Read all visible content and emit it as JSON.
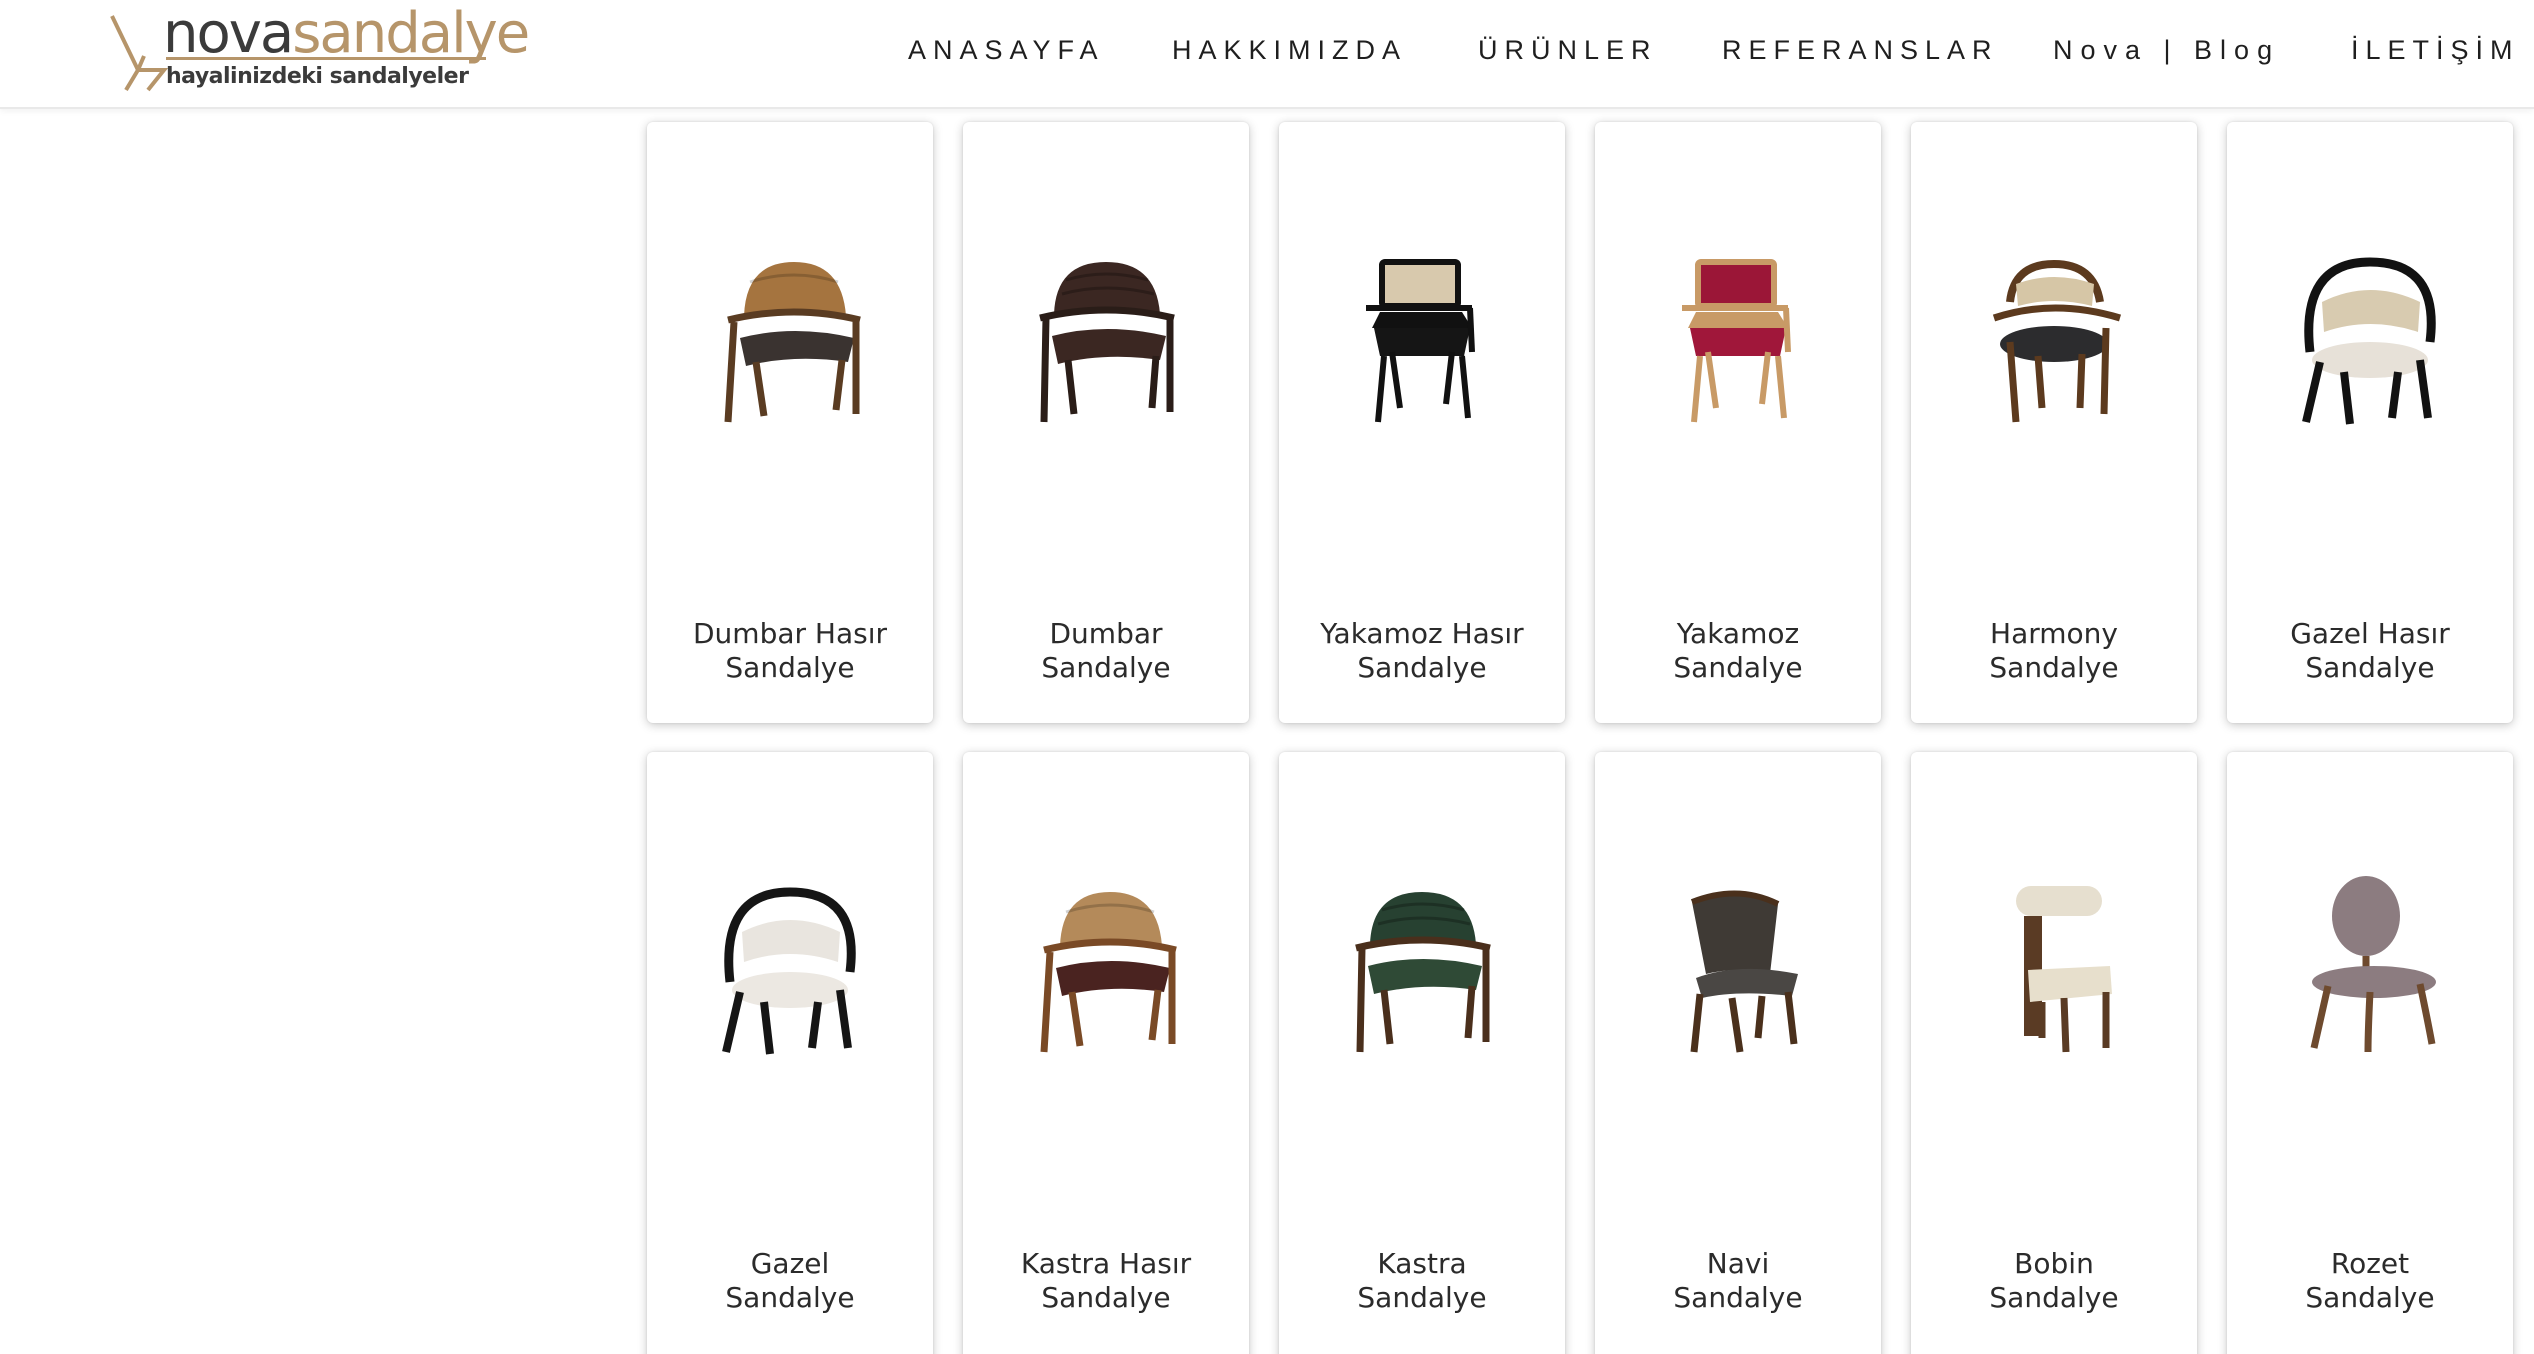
{
  "brand": {
    "name_part1": "nova",
    "name_part2": "sandalye",
    "tagline": "hayalinizdeki sandalyeler",
    "colors": {
      "gold": "#b6956a",
      "dark": "#3b3b3b"
    }
  },
  "nav": [
    {
      "label": "ANASAYFA"
    },
    {
      "label": "HAKKIMIZDA"
    },
    {
      "label": "ÜRÜNLER"
    },
    {
      "label": "REFERANSLAR"
    },
    {
      "label": "Nova | Blog"
    },
    {
      "label": "İLETİŞİM"
    }
  ],
  "products": [
    {
      "title_line1": "Dumbar Hasır",
      "title_line2": "Sandalye",
      "frame": "#5a3c22",
      "back": "#a5743f",
      "seat": "#3a3330",
      "style": "arm-cane"
    },
    {
      "title_line1": "Dumbar",
      "title_line2": "Sandalye",
      "frame": "#2a1d18",
      "back": "#3b2722",
      "seat": "#3b2722",
      "style": "arm-leather"
    },
    {
      "title_line1": "Yakamoz Hasır",
      "title_line2": "Sandalye",
      "frame": "#111111",
      "back": "#d8c9ad",
      "seat": "#151515",
      "style": "square-arm"
    },
    {
      "title_line1": "Yakamoz",
      "title_line2": "Sandalye",
      "frame": "#c89a66",
      "back": "#9b1637",
      "seat": "#a0173a",
      "style": "square-arm"
    },
    {
      "title_line1": "Harmony",
      "title_line2": "Sandalye",
      "frame": "#5c3a1e",
      "back": "#d6c6a6",
      "seat": "#2c2c2e",
      "style": "round-arm"
    },
    {
      "title_line1": "Gazel Hasır",
      "title_line2": "Sandalye",
      "frame": "#121212",
      "back": "#d8cbb0",
      "seat": "#e7e1d8",
      "style": "hoop"
    },
    {
      "title_line1": "Gazel",
      "title_line2": "Sandalye",
      "frame": "#151515",
      "back": "#e9e5df",
      "seat": "#ece8e2",
      "style": "hoop"
    },
    {
      "title_line1": "Kastra Hasır",
      "title_line2": "Sandalye",
      "frame": "#7a4a26",
      "back": "#b48a5a",
      "seat": "#4a2320",
      "style": "arm-cane"
    },
    {
      "title_line1": "Kastra",
      "title_line2": "Sandalye",
      "frame": "#4a2f1c",
      "back": "#274131",
      "seat": "#2f4a36",
      "style": "arm-leather"
    },
    {
      "title_line1": "Navi",
      "title_line2": "Sandalye",
      "frame": "#4a301c",
      "back": "#3f3a35",
      "seat": "#4a4744",
      "style": "side-curve"
    },
    {
      "title_line1": "Bobin",
      "title_line2": "Sandalye",
      "frame": "#5a3b24",
      "back": "#e6dfcf",
      "seat": "#e7dfcc",
      "style": "bobin"
    },
    {
      "title_line1": "Rozet",
      "title_line2": "Sandalye",
      "frame": "#6e4a2e",
      "back": "#8c7c80",
      "seat": "#8c7c80",
      "style": "oval"
    }
  ]
}
